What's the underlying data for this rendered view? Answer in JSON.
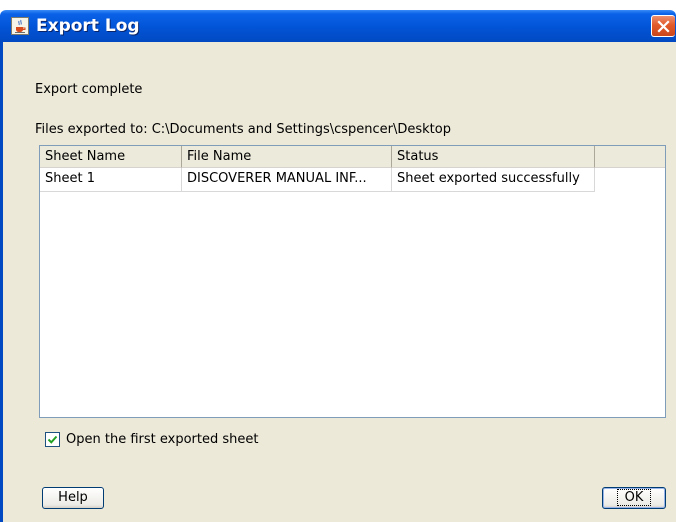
{
  "window": {
    "title": "Export Log",
    "icon": "java-cup-icon"
  },
  "message": "Export complete",
  "path_text": "Files exported to: C:\\Documents and Settings\\cspencer\\Desktop",
  "table": {
    "columns": [
      "Sheet Name",
      "File Name",
      "Status"
    ],
    "rows": [
      [
        "Sheet 1",
        "DISCOVERER MANUAL INF...",
        "Sheet exported successfully"
      ]
    ]
  },
  "checkbox": {
    "label": "Open the first exported sheet",
    "checked": true
  },
  "buttons": {
    "help": "Help",
    "ok": "OK"
  },
  "colors": {
    "titlebar": "#0254d6",
    "close_button": "#e25a2a",
    "dialog_bg": "#ece9d8"
  }
}
